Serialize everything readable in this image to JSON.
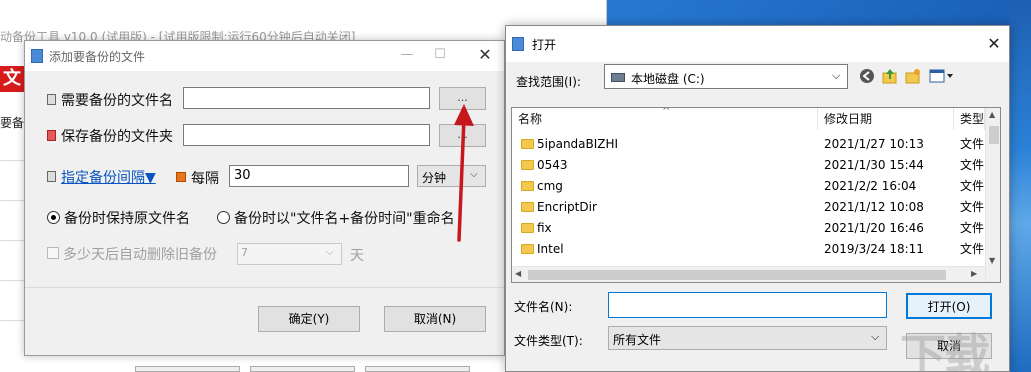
{
  "background_window": {
    "title": "动备份工具 v10.0 (试用版) - [试用版限制:运行60分钟后自动关闭]",
    "logo_text": "文件",
    "sidebar_text": "要备份"
  },
  "add_dialog": {
    "title": "添加要备份的文件",
    "file_label": "需要备份的文件名",
    "file_value": "",
    "browse_file": "...",
    "folder_label": "保存备份的文件夹",
    "folder_value": "",
    "browse_folder": "...",
    "interval_link": "指定备份间隔▼",
    "every_label": "每隔",
    "every_value": "30",
    "unit_value": "分钟",
    "radio_keep": "备份时保持原文件名",
    "radio_rename": "备份时以\"文件名+备份时间\"重命名",
    "auto_delete_label": "多少天后自动删除旧备份",
    "auto_delete_value": "7",
    "days_unit": "天",
    "ok_button": "确定(Y)",
    "cancel_button": "取消(N)"
  },
  "open_dialog": {
    "title": "打开",
    "lookin_label": "查找范围(I):",
    "lookin_value": "本地磁盘 (C:)",
    "columns": [
      "名称",
      "修改日期",
      "类型"
    ],
    "rows": [
      {
        "name": "5ipandaBIZHI",
        "date": "2021/1/27 10:13",
        "type": "文件"
      },
      {
        "name": "0543",
        "date": "2021/1/30 15:44",
        "type": "文件"
      },
      {
        "name": "cmg",
        "date": "2021/2/2 16:04",
        "type": "文件"
      },
      {
        "name": "EncriptDir",
        "date": "2021/1/12 10:08",
        "type": "文件"
      },
      {
        "name": "fix",
        "date": "2021/1/20 16:46",
        "type": "文件"
      },
      {
        "name": "Intel",
        "date": "2019/3/24 18:11",
        "type": "文件"
      }
    ],
    "filename_label": "文件名(N):",
    "filename_value": "",
    "filetype_label": "文件类型(T):",
    "filetype_value": "所有文件",
    "open_button": "打开(O)",
    "cancel_button": "取消"
  },
  "colors": {
    "link": "#0a54c2",
    "accent": "#0078d7",
    "arrow": "#c8161d"
  }
}
